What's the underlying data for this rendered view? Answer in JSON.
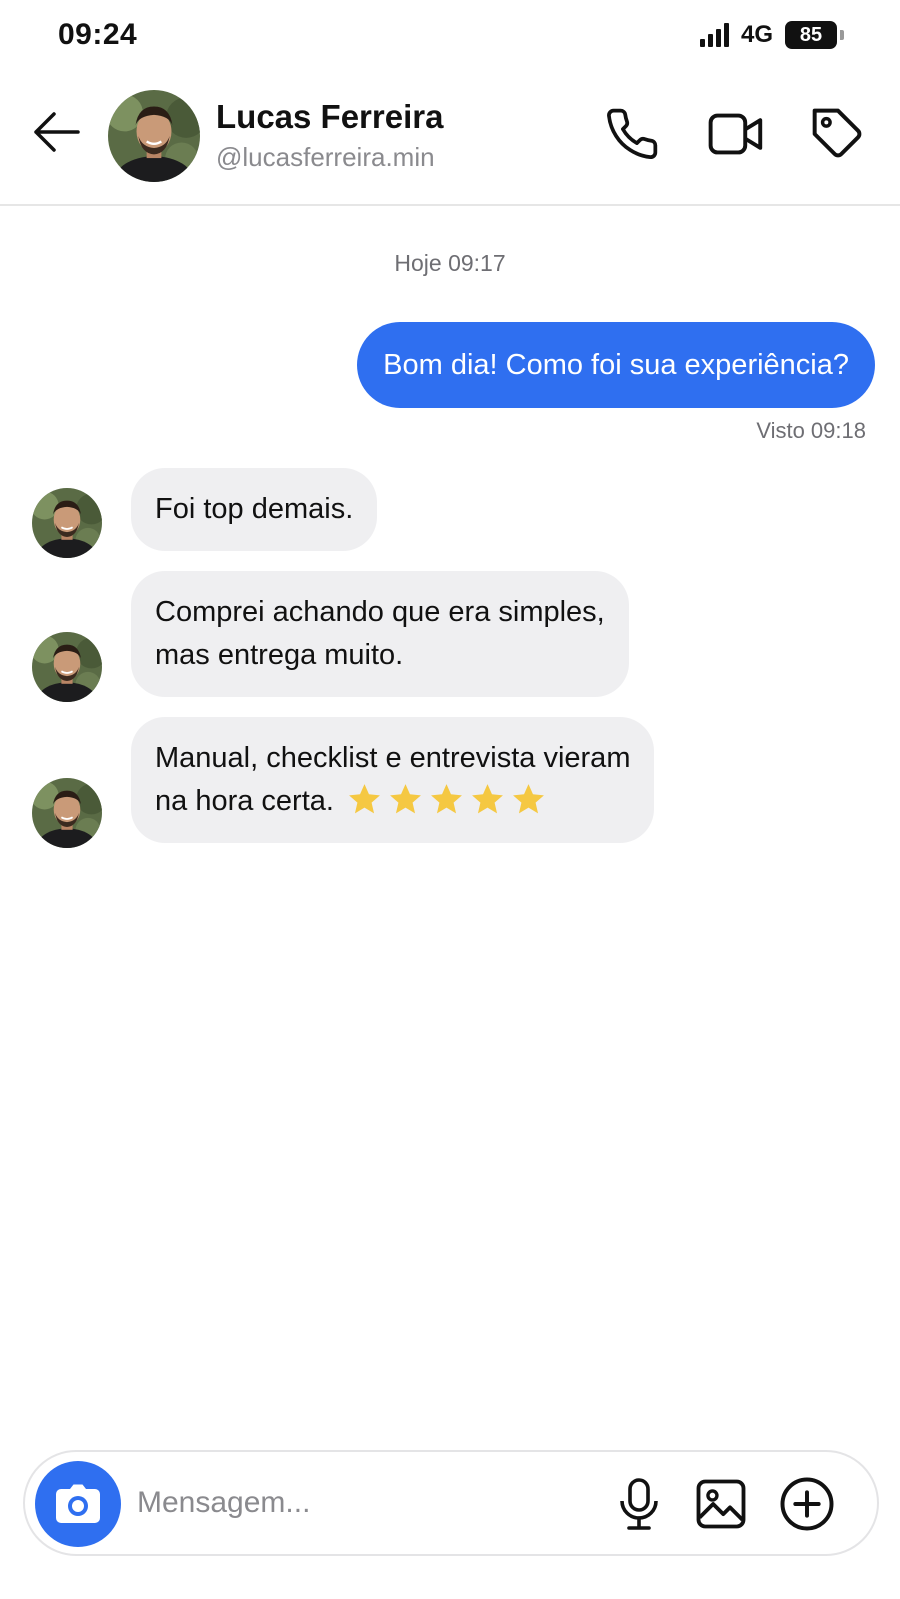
{
  "status_bar": {
    "time": "09:24",
    "network": "4G",
    "battery": "85"
  },
  "header": {
    "contact_name": "Lucas Ferreira",
    "contact_handle": "@lucasferreira.min",
    "icons": [
      "back-arrow-icon",
      "phone-icon",
      "video-camera-icon",
      "tag-icon"
    ]
  },
  "conversation": {
    "day_stamp": "Hoje 09:17",
    "outgoing": {
      "text": "Bom dia! Como foi sua experiência?",
      "status": "Visto 09:18"
    },
    "incoming": [
      {
        "lines": [
          "Foi top demais."
        ]
      },
      {
        "lines": [
          "Comprei achando que era simples,",
          "mas entrega muito."
        ]
      },
      {
        "lines": [
          "Manual, checklist e entrevista vieram",
          "na hora certa."
        ],
        "rating": 5
      }
    ]
  },
  "composer": {
    "placeholder": "Mensagem...",
    "icons": [
      "camera-icon",
      "microphone-icon",
      "image-icon",
      "plus-circle-icon"
    ]
  },
  "colors": {
    "accent": "#2f6ff0",
    "incoming_bubble": "#efeff1",
    "star": "#f5c842",
    "muted_text": "#6e6e73"
  }
}
